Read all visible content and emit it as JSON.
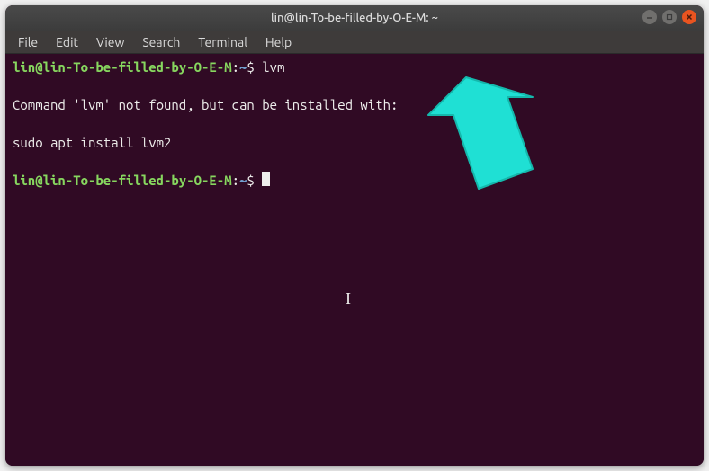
{
  "window": {
    "title": "lin@lin-To-be-filled-by-O-E-M: ~"
  },
  "menubar": {
    "items": [
      "File",
      "Edit",
      "View",
      "Search",
      "Terminal",
      "Help"
    ]
  },
  "terminal": {
    "prompt_user_host": "lin@lin-To-be-filled-by-O-E-M",
    "prompt_path": "~",
    "prompt_symbol": "$",
    "lines": {
      "cmd1": "lvm",
      "out1": "Command 'lvm' not found, but can be installed with:",
      "out2": "sudo apt install lvm2"
    }
  },
  "colors": {
    "bg": "#300a24",
    "prompt_green": "#87d75f",
    "prompt_blue": "#729fcf",
    "text": "#eeeeec",
    "close": "#e95420",
    "arrow": "#1fe0d4"
  }
}
